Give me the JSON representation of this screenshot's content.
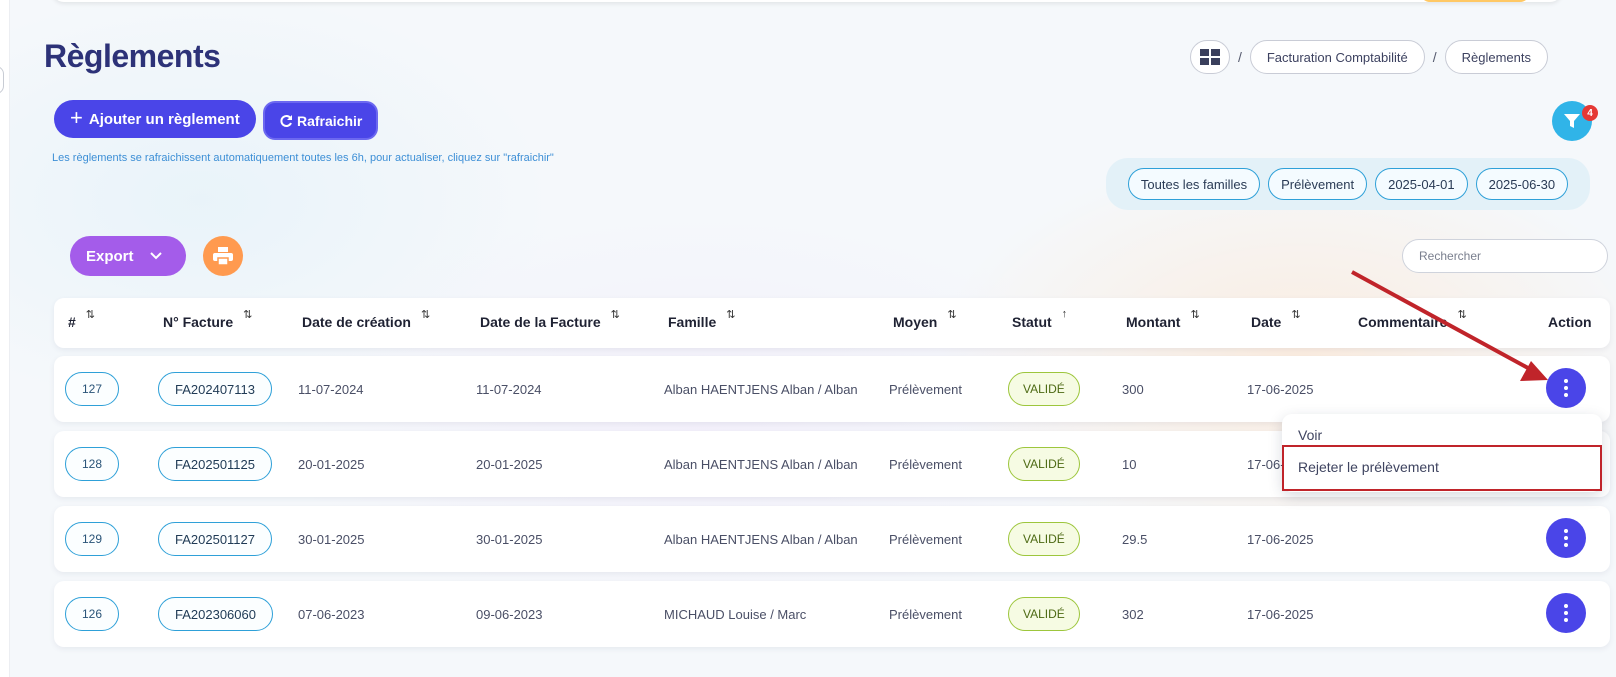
{
  "page": {
    "title": "Règlements"
  },
  "breadcrumb": {
    "items": [
      "Facturation Comptabilité",
      "Règlements"
    ],
    "separator": "/"
  },
  "toolbar": {
    "add_label": "Ajouter un règlement",
    "refresh_label": "Rafraichir",
    "info_text": "Les règlements se rafraichissent automatiquement toutes les 6h, pour actualiser, cliquez sur \"rafraichir\"",
    "export_label": "Export",
    "filter_count": "4"
  },
  "filters": {
    "chips": [
      "Toutes les familles",
      "Prélèvement",
      "2025-04-01",
      "2025-06-30"
    ]
  },
  "search": {
    "placeholder": "Rechercher",
    "value": ""
  },
  "table": {
    "columns": [
      "#",
      "N° Facture",
      "Date de création",
      "Date de la Facture",
      "Famille",
      "Moyen",
      "Statut",
      "Montant",
      "Date",
      "Commentaire",
      "Action"
    ],
    "rows": [
      {
        "id": "127",
        "facture": "FA202407113",
        "creation": "11-07-2024",
        "date_facture": "11-07-2024",
        "famille": "Alban HAENTJENS Alban / Alban",
        "moyen": "Prélèvement",
        "statut": "VALIDÉ",
        "montant": "300",
        "date": "17-06-2025",
        "commentaire": ""
      },
      {
        "id": "128",
        "facture": "FA202501125",
        "creation": "20-01-2025",
        "date_facture": "20-01-2025",
        "famille": "Alban HAENTJENS Alban / Alban",
        "moyen": "Prélèvement",
        "statut": "VALIDÉ",
        "montant": "10",
        "date": "17-06-",
        "commentaire": ""
      },
      {
        "id": "129",
        "facture": "FA202501127",
        "creation": "30-01-2025",
        "date_facture": "30-01-2025",
        "famille": "Alban HAENTJENS Alban / Alban",
        "moyen": "Prélèvement",
        "statut": "VALIDÉ",
        "montant": "29.5",
        "date": "17-06-2025",
        "commentaire": ""
      },
      {
        "id": "126",
        "facture": "FA202306060",
        "creation": "07-06-2023",
        "date_facture": "09-06-2023",
        "famille": "MICHAUD Louise / Marc",
        "moyen": "Prélèvement",
        "statut": "VALIDÉ",
        "montant": "302",
        "date": "17-06-2025",
        "commentaire": ""
      }
    ]
  },
  "action_menu": {
    "items": [
      "Voir",
      "Rejeter le prélèvement"
    ]
  },
  "colors": {
    "primary": "#4a45e8",
    "title": "#2d3278",
    "export": "#a45cea",
    "print": "#ff9a4f",
    "filter": "#30b4e8",
    "annotation": "#c0242a"
  },
  "icons": {
    "home": "grid-icon",
    "add": "plus-icon",
    "refresh": "refresh-icon",
    "export": "chevron-down-icon",
    "print": "printer-icon",
    "filter": "filter-icon",
    "sort": "sort-icon",
    "action": "more-vertical-icon"
  }
}
